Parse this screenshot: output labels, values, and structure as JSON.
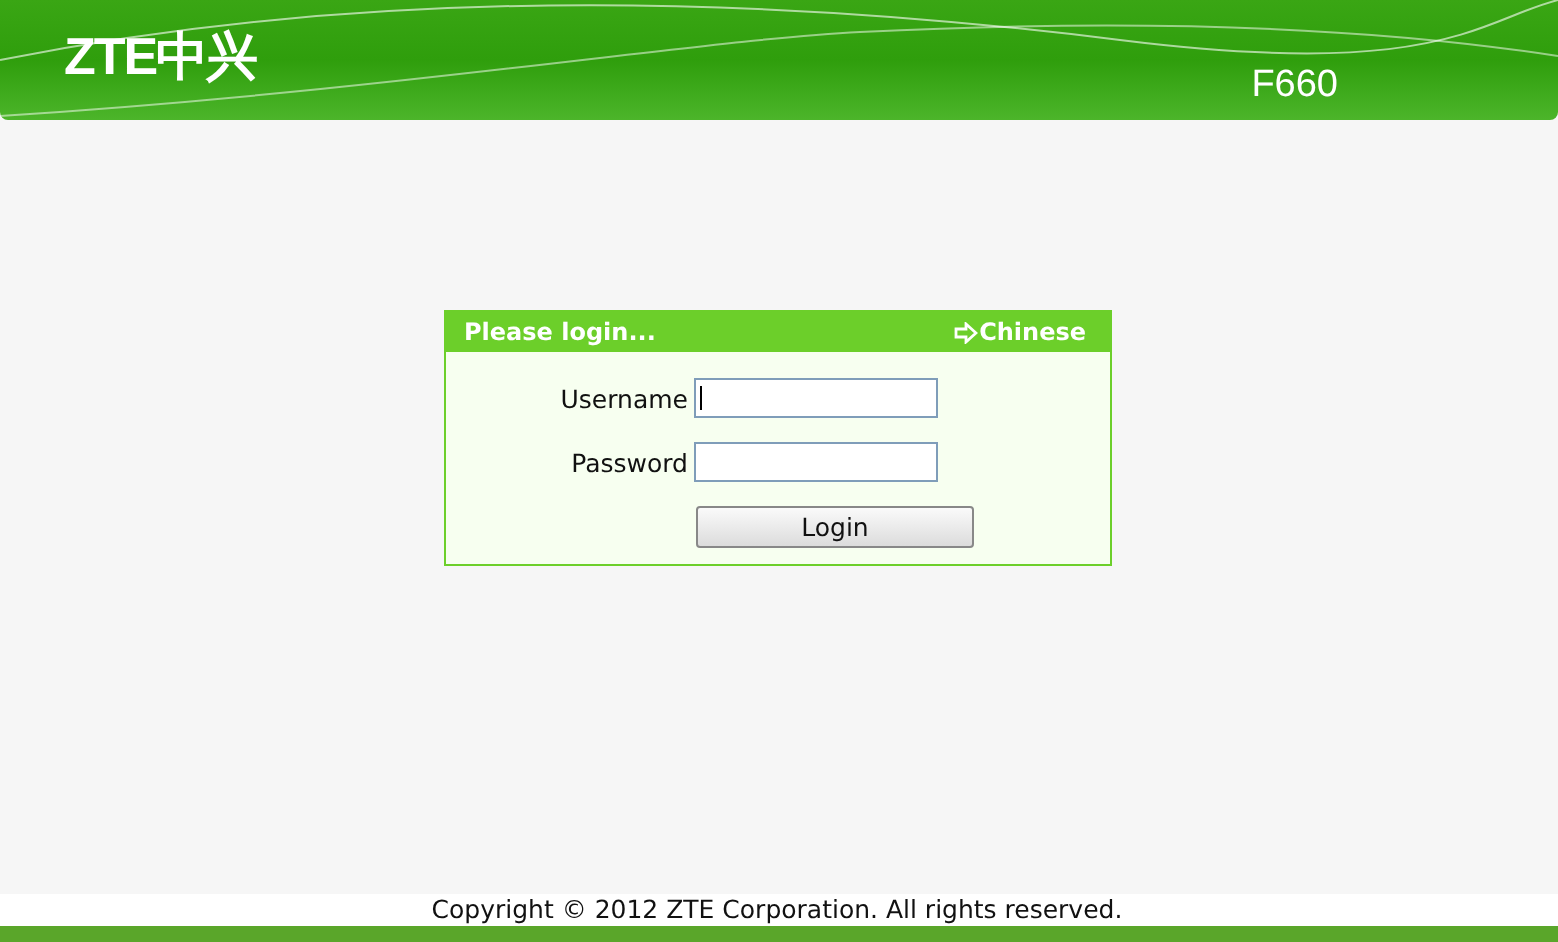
{
  "header": {
    "logo": "ZTE中兴",
    "model": "F660"
  },
  "login": {
    "title": "Please login...",
    "language_link": "Chinese",
    "fields": [
      {
        "label": "Username",
        "focused": true
      },
      {
        "label": "Password",
        "focused": false
      }
    ],
    "button": "Login"
  },
  "footer": {
    "copyright": "Copyright © 2012 ZTE Corporation. All rights reserved."
  }
}
